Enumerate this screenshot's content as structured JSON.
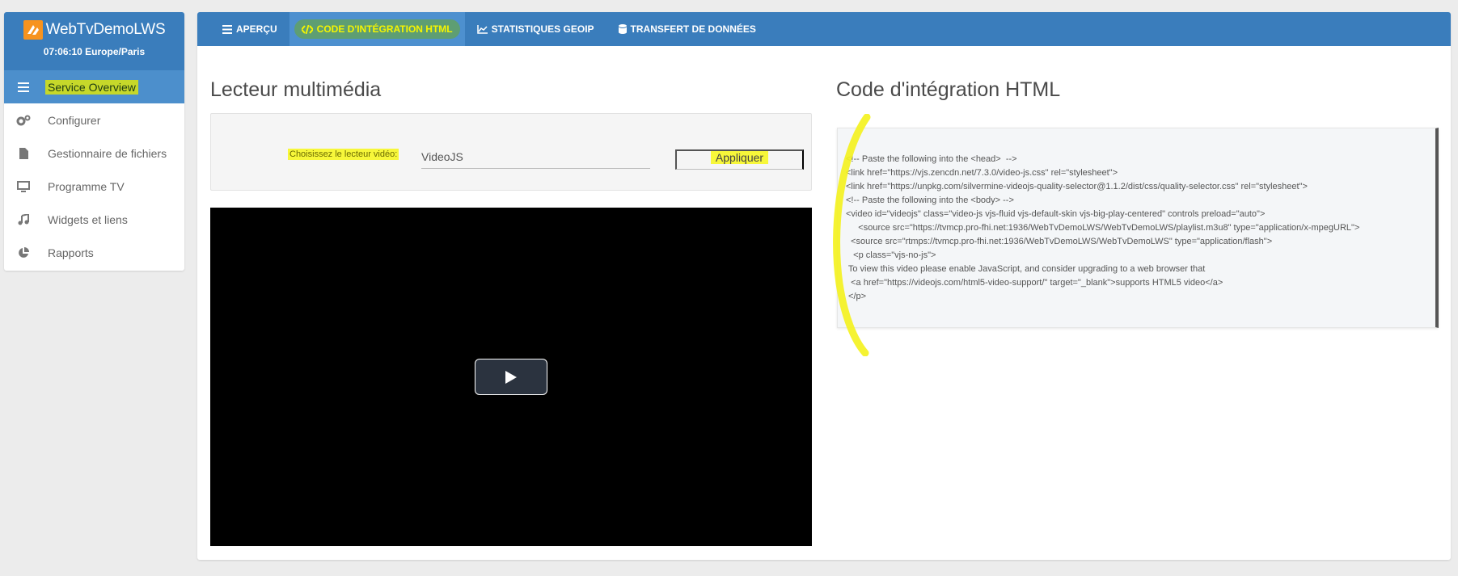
{
  "sidebar": {
    "brand": "WebTvDemoLWS",
    "clock": "07:06:10 Europe/Paris",
    "items": [
      {
        "label": "Service Overview",
        "icon": "bars-icon"
      },
      {
        "label": "Configurer",
        "icon": "cogs-icon"
      },
      {
        "label": "Gestionnaire de fichiers",
        "icon": "file-icon"
      },
      {
        "label": "Programme TV",
        "icon": "monitor-icon"
      },
      {
        "label": "Widgets et liens",
        "icon": "music-icon"
      },
      {
        "label": "Rapports",
        "icon": "pie-chart-icon"
      }
    ]
  },
  "tabs": [
    {
      "label": "APERÇU",
      "icon": "list-icon"
    },
    {
      "label": "CODE D'INTÉGRATION HTML",
      "icon": "code-icon"
    },
    {
      "label": "STATISTIQUES GEOIP",
      "icon": "area-chart-icon"
    },
    {
      "label": "TRANSFERT DE DONNÉES",
      "icon": "database-icon"
    }
  ],
  "player": {
    "title": "Lecteur multimédia",
    "select_label": "Choisissez le lecteur vidéo:",
    "select_value": "VideoJS",
    "apply_label": "Appliquer"
  },
  "embed": {
    "title": "Code d'intégration HTML",
    "lines": [
      "<!-- Paste the following into the <head>  -->",
      "<link href=\"https://vjs.zencdn.net/7.3.0/video-js.css\" rel=\"stylesheet\">",
      "<link href=\"https://unpkg.com/silvermine-videojs-quality-selector@1.1.2/dist/css/quality-selector.css\" rel=\"stylesheet\">",
      "",
      "<!-- Paste the following into the <body> -->",
      "<video id=\"videojs\" class=\"video-js vjs-fluid vjs-default-skin vjs-big-play-centered\" controls preload=\"auto\">",
      "",
      "     <source src=\"https://tvmcp.pro-fhi.net:1936/WebTvDemoLWS/WebTvDemoLWS/playlist.m3u8\" type=\"application/x-mpegURL\">",
      "  <source src=\"rtmps://tvmcp.pro-fhi.net:1936/WebTvDemoLWS/WebTvDemoLWS\" type=\"application/flash\">",
      "   <p class=\"vjs-no-js\">",
      " To view this video please enable JavaScript, and consider upgrading to a web browser that",
      "  <a href=\"https://videojs.com/html5-video-support/\" target=\"_blank\">supports HTML5 video</a>",
      " </p>"
    ]
  },
  "colors": {
    "header_blue": "#3a7dbc",
    "active_blue": "#4c8fcc",
    "highlight_yellow": "#f7f73a",
    "highlight_green": "#c6d82a",
    "logo_orange": "#f7931e"
  }
}
